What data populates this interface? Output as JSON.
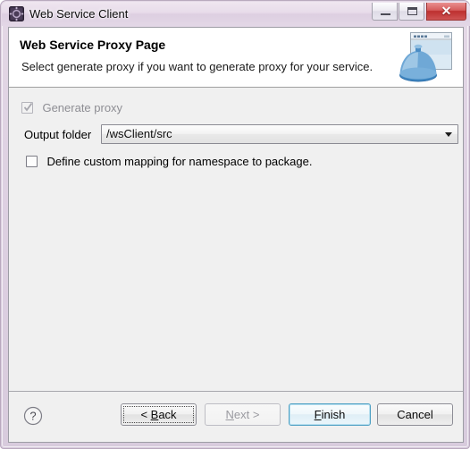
{
  "window": {
    "title": "Web Service Client",
    "icon": "web-service-icon",
    "controls": {
      "minimize": "Minimize",
      "maximize": "Maximize",
      "close": "Close",
      "close_glyph": "✕"
    }
  },
  "header": {
    "title": "Web Service Proxy Page",
    "description": "Select generate proxy if you want to generate proxy for your service.",
    "banner_icon": "web-service-banner-icon"
  },
  "content": {
    "generate_proxy": {
      "label": "Generate proxy",
      "checked": true,
      "enabled": false
    },
    "output_folder": {
      "label": "Output folder",
      "value": "/wsClient/src"
    },
    "custom_mapping": {
      "label": "Define custom mapping for namespace to package.",
      "checked": false,
      "enabled": true
    }
  },
  "buttons": {
    "help": "?",
    "back": "< Back",
    "back_mnemonic": "B",
    "next": "Next >",
    "next_mnemonic": "N",
    "finish": "Finish",
    "finish_mnemonic": "F",
    "cancel": "Cancel"
  },
  "colors": {
    "accent": "#4ea0c4",
    "titlebar": "#e4d8e6",
    "close_button": "#bd2f2f",
    "dialog_bg": "#f0f0f0",
    "header_bg": "#ffffff"
  }
}
